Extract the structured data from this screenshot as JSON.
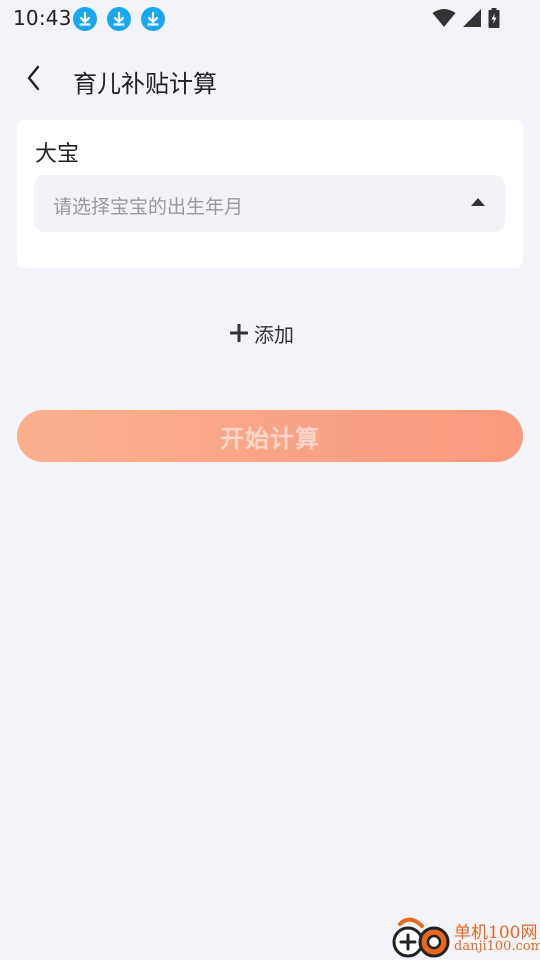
{
  "status_bar": {
    "time": "10:43",
    "download_icons": [
      "download-icon",
      "download-icon",
      "download-icon"
    ],
    "system_icons": [
      "wifi-icon",
      "cell-signal-icon",
      "battery-charging-icon"
    ]
  },
  "header": {
    "back_icon": "chevron-left-icon",
    "title": "育儿补贴计算"
  },
  "children": [
    {
      "label": "大宝",
      "birth_select": {
        "placeholder": "请选择宝宝的出生年月",
        "icon": "triangle-up-icon"
      }
    }
  ],
  "add": {
    "icon": "plus-icon",
    "label": "添加"
  },
  "calculate": {
    "label": "开始计算"
  },
  "watermark": {
    "name": "单机100网",
    "url": "danji100.com"
  },
  "colors": {
    "background": "#f3f4f9",
    "card": "#ffffff",
    "select_bg": "#f2f3f7",
    "accent_start": "#fbb08c",
    "accent_end": "#fb9a7d",
    "download_blue": "#1aa6f2",
    "watermark_orange": "#e8681f"
  }
}
